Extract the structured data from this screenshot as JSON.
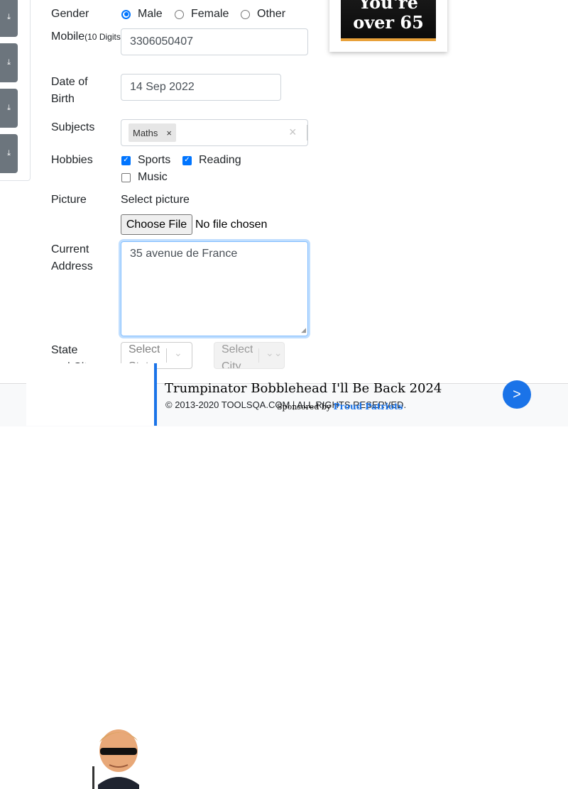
{
  "sidebar": {
    "buttons": [
      {
        "icon": "download-icon"
      },
      {
        "icon": "download-icon"
      },
      {
        "icon": "download-icon"
      },
      {
        "icon": "download-icon"
      }
    ]
  },
  "form": {
    "gender": {
      "label": "Gender",
      "options": [
        "Male",
        "Female",
        "Other"
      ],
      "selected": "Male"
    },
    "mobile": {
      "label": "Mobile",
      "hint": "(10 Digits)",
      "value": "3306050407"
    },
    "dob": {
      "label_line1": "Date of",
      "label_line2": "Birth",
      "value": "14 Sep 2022"
    },
    "subjects": {
      "label": "Subjects",
      "chips": [
        "Maths"
      ],
      "clear_glyph": "×"
    },
    "hobbies": {
      "label": "Hobbies",
      "options": [
        {
          "label": "Sports",
          "checked": true
        },
        {
          "label": "Reading",
          "checked": true
        },
        {
          "label": "Music",
          "checked": false
        }
      ]
    },
    "picture": {
      "label": "Picture",
      "select_text": "Select picture",
      "button": "Choose File",
      "status": "No file chosen"
    },
    "address": {
      "label_line1": "Current",
      "label_line2": "Address",
      "value": "35 avenue de France"
    },
    "state_city": {
      "label_line1": "State",
      "label_line2": "and City",
      "state_placeholder_line1": "Select",
      "state_placeholder_line2": "State",
      "city_placeholder_line1": "Select",
      "city_placeholder_line2": "City"
    }
  },
  "side_ad": {
    "line1": "You're",
    "line2": "over 65"
  },
  "footer": {
    "copyright": "© 2013-2020 TOOLSQA.COM | ALL RIGHTS RESERVED."
  },
  "bottom_ad": {
    "title": "Trumpinator Bobblehead I'll Be Back 2024",
    "sponsored_prefix": "Sponsored by",
    "sponsor": "Proud Patriots",
    "next_glyph": ">"
  },
  "colors": {
    "accent": "#0075ff",
    "ad_button": "#1a73e8",
    "sponsor_link": "#1a73e8"
  }
}
